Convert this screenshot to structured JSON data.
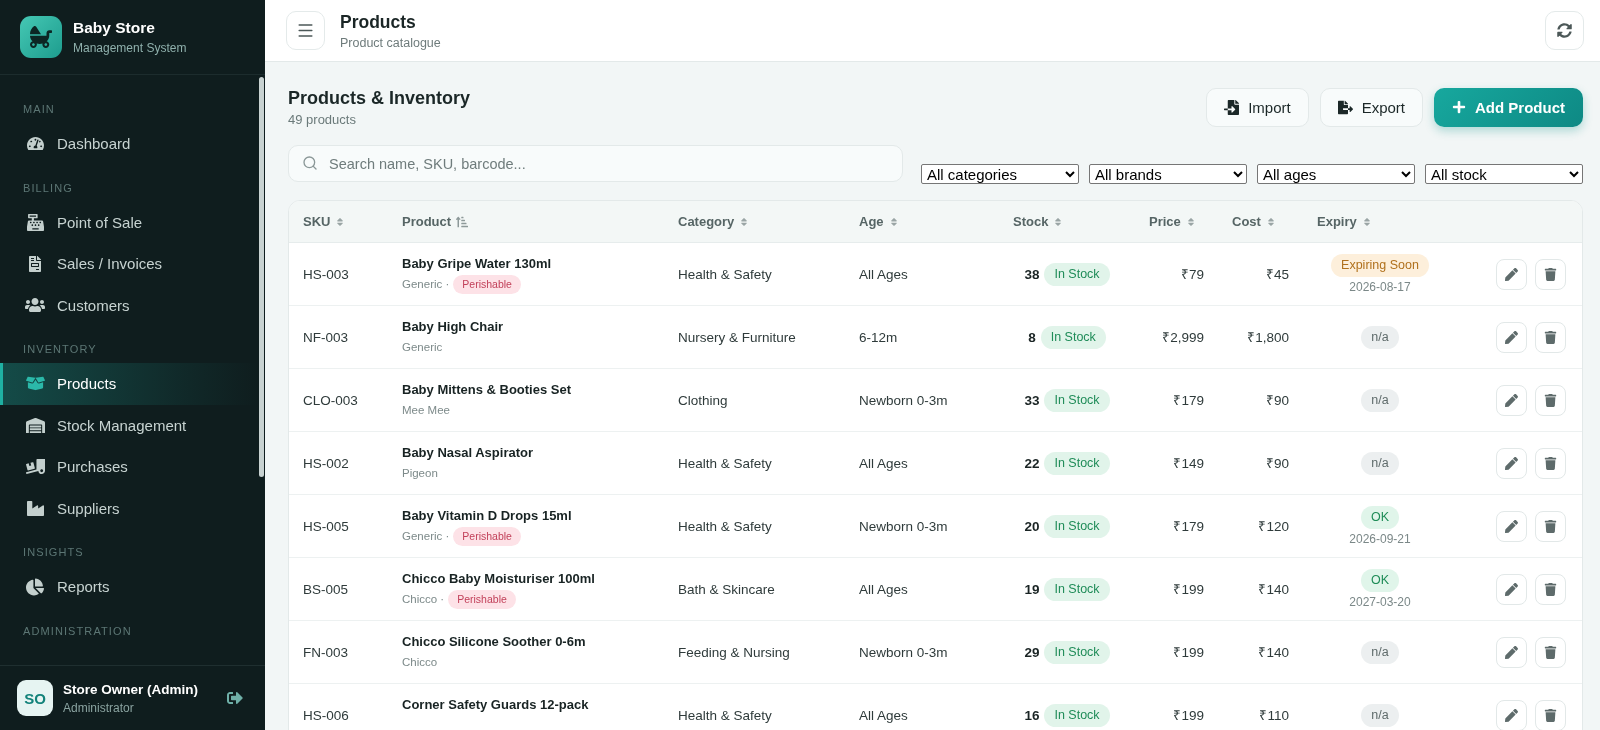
{
  "sidebar": {
    "brand": {
      "title": "Baby Store",
      "subtitle": "Management System"
    },
    "sections": [
      {
        "label": "MAIN",
        "items": [
          {
            "label": "Dashboard",
            "selected": false
          }
        ]
      },
      {
        "label": "BILLING",
        "items": [
          {
            "label": "Point of Sale",
            "selected": false
          },
          {
            "label": "Sales / Invoices",
            "selected": false
          },
          {
            "label": "Customers",
            "selected": false
          }
        ]
      },
      {
        "label": "INVENTORY",
        "items": [
          {
            "label": "Products",
            "selected": true
          },
          {
            "label": "Stock Management",
            "selected": false
          },
          {
            "label": "Purchases",
            "selected": false
          },
          {
            "label": "Suppliers",
            "selected": false
          }
        ]
      },
      {
        "label": "INSIGHTS",
        "items": [
          {
            "label": "Reports",
            "selected": false
          }
        ]
      },
      {
        "label": "ADMINISTRATION"
      }
    ],
    "user": {
      "initials": "SO",
      "name": "Store Owner (Admin)",
      "role": "Administrator"
    }
  },
  "header": {
    "title": "Products",
    "subtitle": "Product catalogue"
  },
  "page": {
    "title": "Products & Inventory",
    "count": "49 products",
    "buttons": [
      {
        "label": "Import",
        "kind": "secondary"
      },
      {
        "label": "Export",
        "kind": "secondary"
      },
      {
        "label": "Add Product",
        "kind": "primary"
      }
    ]
  },
  "filters": {
    "search": {
      "placeholder": "Search name, SKU, barcode..."
    },
    "selects": [
      {
        "value": "All categories"
      },
      {
        "value": "All brands"
      },
      {
        "value": "All ages"
      },
      {
        "value": "All stock"
      }
    ]
  },
  "table": {
    "columns": [
      {
        "label": "SKU",
        "sorted": false
      },
      {
        "label": "Product",
        "sorted": true
      },
      {
        "label": "Category",
        "sorted": false
      },
      {
        "label": "Age",
        "sorted": false
      },
      {
        "label": "Stock",
        "sorted": false
      },
      {
        "label": "Price",
        "sorted": false
      },
      {
        "label": "Cost",
        "sorted": false
      },
      {
        "label": "Expiry",
        "sorted": false
      }
    ],
    "rows": [
      {
        "sku": "HS-003",
        "name": "Baby Gripe Water 130ml",
        "brand": "Generic ·",
        "tag": "Perishable",
        "category": "Health & Safety",
        "age": "All Ages",
        "stock": "38",
        "stock_status": {
          "label": "In Stock",
          "kind": "in"
        },
        "price": "₹79",
        "cost": "₹45",
        "expiry": {
          "label": "Expiring Soon",
          "kind": "soon",
          "date": "2026-08-17"
        }
      },
      {
        "sku": "NF-003",
        "name": "Baby High Chair",
        "brand": "Generic",
        "category": "Nursery & Furniture",
        "age": "6-12m",
        "stock": "8",
        "stock_status": {
          "label": "In Stock",
          "kind": "in"
        },
        "price": "₹2,999",
        "cost": "₹1,800",
        "expiry": {
          "label": "n/a",
          "kind": "none"
        }
      },
      {
        "sku": "CLO-003",
        "name": "Baby Mittens & Booties Set",
        "brand": "Mee Mee",
        "category": "Clothing",
        "age": "Newborn 0-3m",
        "stock": "33",
        "stock_status": {
          "label": "In Stock",
          "kind": "in"
        },
        "price": "₹179",
        "cost": "₹90",
        "expiry": {
          "label": "n/a",
          "kind": "none"
        }
      },
      {
        "sku": "HS-002",
        "name": "Baby Nasal Aspirator",
        "brand": "Pigeon",
        "category": "Health & Safety",
        "age": "All Ages",
        "stock": "22",
        "stock_status": {
          "label": "In Stock",
          "kind": "in"
        },
        "price": "₹149",
        "cost": "₹90",
        "expiry": {
          "label": "n/a",
          "kind": "none"
        }
      },
      {
        "sku": "HS-005",
        "name": "Baby Vitamin D Drops 15ml",
        "brand": "Generic ·",
        "tag": "Perishable",
        "category": "Health & Safety",
        "age": "Newborn 0-3m",
        "stock": "20",
        "stock_status": {
          "label": "In Stock",
          "kind": "in"
        },
        "price": "₹179",
        "cost": "₹120",
        "expiry": {
          "label": "OK",
          "kind": "ok",
          "date": "2026-09-21"
        }
      },
      {
        "sku": "BS-005",
        "name": "Chicco Baby Moisturiser 100ml",
        "brand": "Chicco ·",
        "tag": "Perishable",
        "category": "Bath & Skincare",
        "age": "All Ages",
        "stock": "19",
        "stock_status": {
          "label": "In Stock",
          "kind": "in"
        },
        "price": "₹199",
        "cost": "₹140",
        "expiry": {
          "label": "OK",
          "kind": "ok",
          "date": "2027-03-20"
        }
      },
      {
        "sku": "FN-003",
        "name": "Chicco Silicone Soother 0-6m",
        "brand": "Chicco",
        "category": "Feeding & Nursing",
        "age": "Newborn 0-3m",
        "stock": "29",
        "stock_status": {
          "label": "In Stock",
          "kind": "in"
        },
        "price": "₹199",
        "cost": "₹140",
        "expiry": {
          "label": "n/a",
          "kind": "none"
        }
      },
      {
        "sku": "HS-006",
        "name": "Corner Safety Guards 12-pack",
        "category": "Health & Safety",
        "age": "All Ages",
        "stock": "16",
        "stock_status": {
          "label": "In Stock",
          "kind": "in"
        },
        "price": "₹199",
        "cost": "₹110",
        "expiry": {
          "label": "n/a",
          "kind": "none"
        }
      }
    ]
  }
}
